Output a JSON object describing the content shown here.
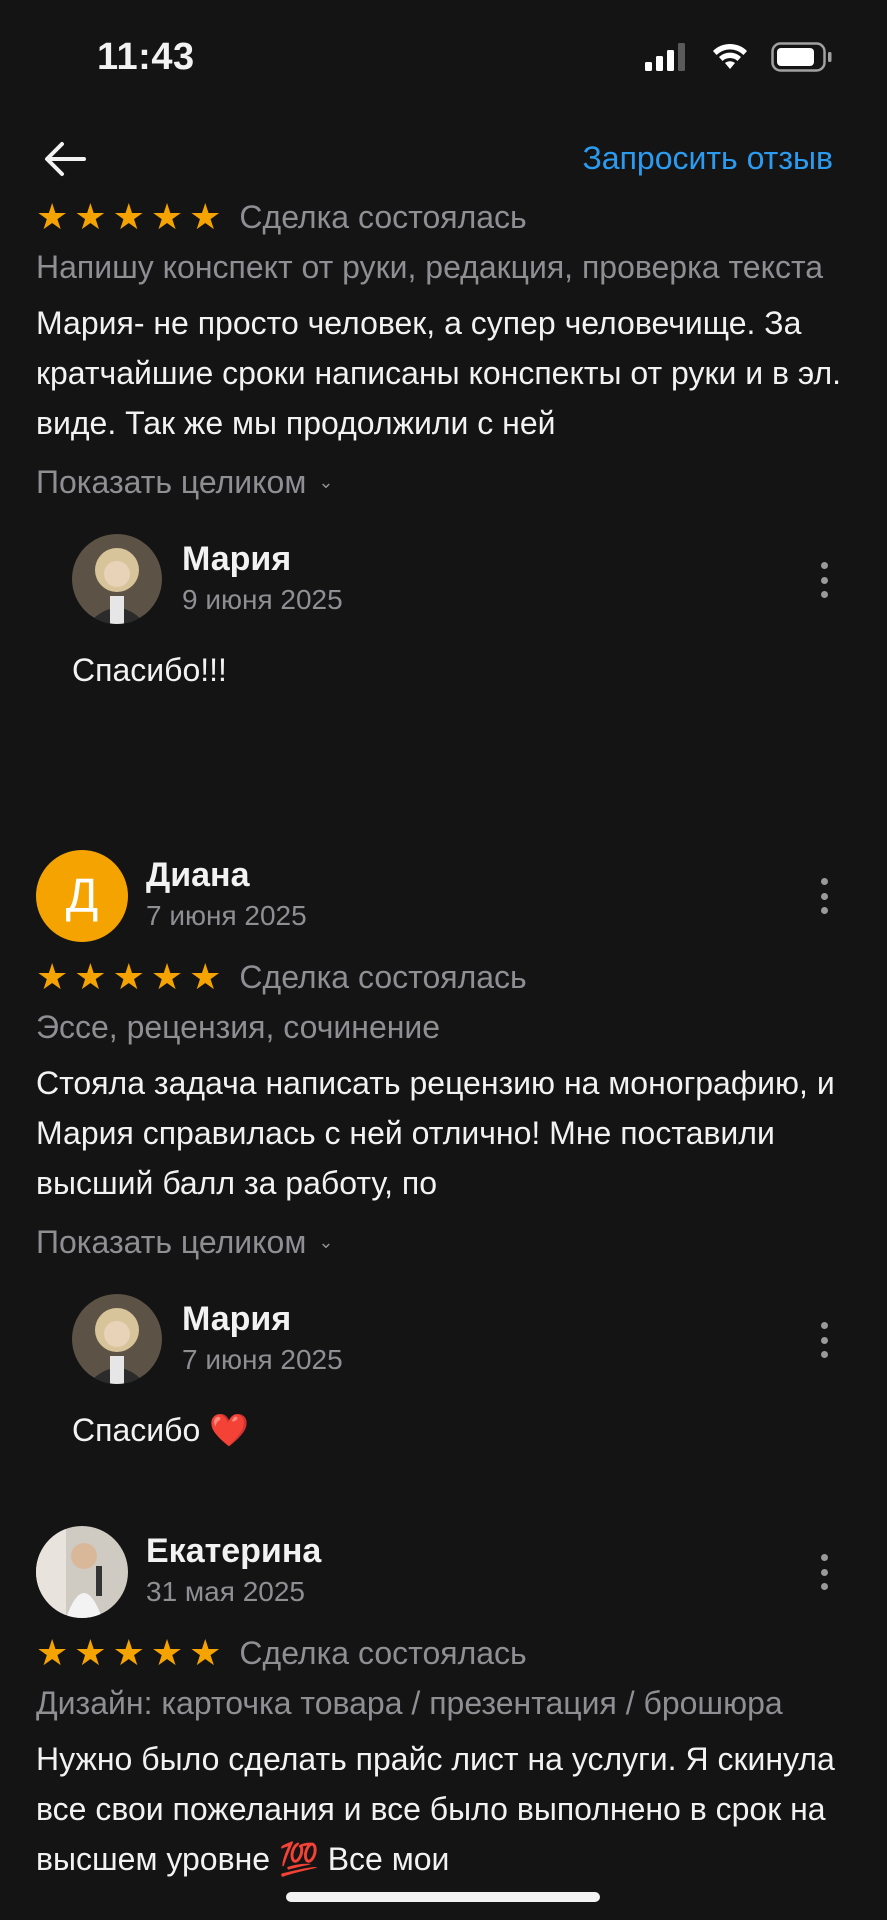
{
  "status_bar": {
    "time": "11:43"
  },
  "nav": {
    "request_label": "Запросить отзыв"
  },
  "partial_top": {
    "date": "9 июня 2025"
  },
  "reviews": [
    {
      "rating": 5,
      "deal_status": "Сделка состоялась",
      "category": "Напишу конспект от руки, редакция, проверка текста",
      "text": "Мария- не просто человек, а супер человечище. За кратчайшие сроки написаны конспекты от руки и в эл. виде. Так же мы продолжили с ней",
      "show_more": "Показать целиком",
      "reply": {
        "name": "Мария",
        "date": "9 июня 2025",
        "text": "Спасибо!!!"
      }
    },
    {
      "name": "Диана",
      "initial": "Д",
      "date": "7 июня 2025",
      "rating": 5,
      "deal_status": "Сделка состоялась",
      "category": "Эссе, рецензия, сочинение",
      "text": "Стояла задача написать рецензию на монографию, и Мария справилась с ней отлично! Мне поставили высший балл за работу, по",
      "show_more": "Показать целиком",
      "reply": {
        "name": "Мария",
        "date": "7 июня 2025",
        "text": "Спасибо ❤️"
      }
    },
    {
      "name": "Екатерина",
      "date": "31 мая 2025",
      "rating": 5,
      "deal_status": "Сделка состоялась",
      "category": "Дизайн: карточка товара / презентация / брошюра",
      "text": "Нужно было сделать прайс лист на услуги. Я скинула все свои пожелания и все было выполнено в срок на высшем уровне 💯 Все мои"
    }
  ],
  "colors": {
    "background": "#141414",
    "accent": "#2b9bf0",
    "star": "#f5a300",
    "muted": "#8e8e93"
  }
}
